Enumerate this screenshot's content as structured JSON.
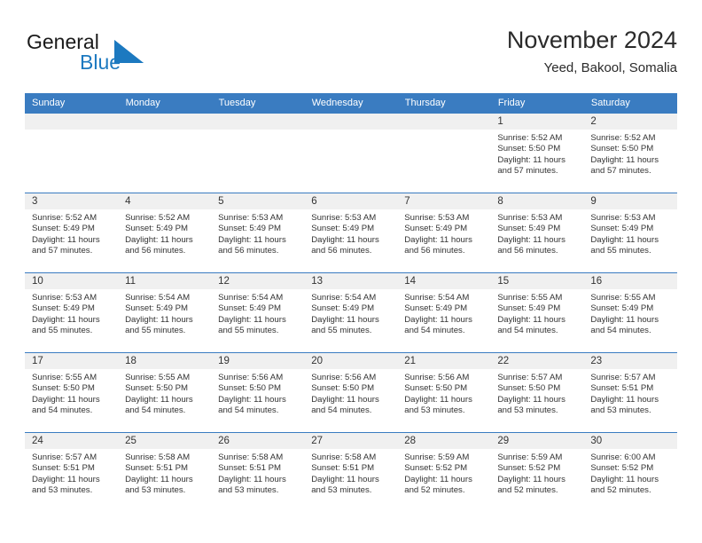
{
  "brand": {
    "name_part1": "General",
    "name_part2": "Blue",
    "accent_color": "#1c79c0",
    "logo_icon": "triangle-logo-icon"
  },
  "header": {
    "title": "November 2024",
    "subtitle": "Yeed, Bakool, Somalia"
  },
  "calendar": {
    "header_bg": "#3a7cc1",
    "daynum_bg": "#f0f0f0",
    "weekdays": [
      "Sunday",
      "Monday",
      "Tuesday",
      "Wednesday",
      "Thursday",
      "Friday",
      "Saturday"
    ],
    "weeks": [
      [
        {
          "day": "",
          "empty": true
        },
        {
          "day": "",
          "empty": true
        },
        {
          "day": "",
          "empty": true
        },
        {
          "day": "",
          "empty": true
        },
        {
          "day": "",
          "empty": true
        },
        {
          "day": "1",
          "sunrise": "Sunrise: 5:52 AM",
          "sunset": "Sunset: 5:50 PM",
          "daylight1": "Daylight: 11 hours",
          "daylight2": "and 57 minutes."
        },
        {
          "day": "2",
          "sunrise": "Sunrise: 5:52 AM",
          "sunset": "Sunset: 5:50 PM",
          "daylight1": "Daylight: 11 hours",
          "daylight2": "and 57 minutes."
        }
      ],
      [
        {
          "day": "3",
          "sunrise": "Sunrise: 5:52 AM",
          "sunset": "Sunset: 5:49 PM",
          "daylight1": "Daylight: 11 hours",
          "daylight2": "and 57 minutes."
        },
        {
          "day": "4",
          "sunrise": "Sunrise: 5:52 AM",
          "sunset": "Sunset: 5:49 PM",
          "daylight1": "Daylight: 11 hours",
          "daylight2": "and 56 minutes."
        },
        {
          "day": "5",
          "sunrise": "Sunrise: 5:53 AM",
          "sunset": "Sunset: 5:49 PM",
          "daylight1": "Daylight: 11 hours",
          "daylight2": "and 56 minutes."
        },
        {
          "day": "6",
          "sunrise": "Sunrise: 5:53 AM",
          "sunset": "Sunset: 5:49 PM",
          "daylight1": "Daylight: 11 hours",
          "daylight2": "and 56 minutes."
        },
        {
          "day": "7",
          "sunrise": "Sunrise: 5:53 AM",
          "sunset": "Sunset: 5:49 PM",
          "daylight1": "Daylight: 11 hours",
          "daylight2": "and 56 minutes."
        },
        {
          "day": "8",
          "sunrise": "Sunrise: 5:53 AM",
          "sunset": "Sunset: 5:49 PM",
          "daylight1": "Daylight: 11 hours",
          "daylight2": "and 56 minutes."
        },
        {
          "day": "9",
          "sunrise": "Sunrise: 5:53 AM",
          "sunset": "Sunset: 5:49 PM",
          "daylight1": "Daylight: 11 hours",
          "daylight2": "and 55 minutes."
        }
      ],
      [
        {
          "day": "10",
          "sunrise": "Sunrise: 5:53 AM",
          "sunset": "Sunset: 5:49 PM",
          "daylight1": "Daylight: 11 hours",
          "daylight2": "and 55 minutes."
        },
        {
          "day": "11",
          "sunrise": "Sunrise: 5:54 AM",
          "sunset": "Sunset: 5:49 PM",
          "daylight1": "Daylight: 11 hours",
          "daylight2": "and 55 minutes."
        },
        {
          "day": "12",
          "sunrise": "Sunrise: 5:54 AM",
          "sunset": "Sunset: 5:49 PM",
          "daylight1": "Daylight: 11 hours",
          "daylight2": "and 55 minutes."
        },
        {
          "day": "13",
          "sunrise": "Sunrise: 5:54 AM",
          "sunset": "Sunset: 5:49 PM",
          "daylight1": "Daylight: 11 hours",
          "daylight2": "and 55 minutes."
        },
        {
          "day": "14",
          "sunrise": "Sunrise: 5:54 AM",
          "sunset": "Sunset: 5:49 PM",
          "daylight1": "Daylight: 11 hours",
          "daylight2": "and 54 minutes."
        },
        {
          "day": "15",
          "sunrise": "Sunrise: 5:55 AM",
          "sunset": "Sunset: 5:49 PM",
          "daylight1": "Daylight: 11 hours",
          "daylight2": "and 54 minutes."
        },
        {
          "day": "16",
          "sunrise": "Sunrise: 5:55 AM",
          "sunset": "Sunset: 5:49 PM",
          "daylight1": "Daylight: 11 hours",
          "daylight2": "and 54 minutes."
        }
      ],
      [
        {
          "day": "17",
          "sunrise": "Sunrise: 5:55 AM",
          "sunset": "Sunset: 5:50 PM",
          "daylight1": "Daylight: 11 hours",
          "daylight2": "and 54 minutes."
        },
        {
          "day": "18",
          "sunrise": "Sunrise: 5:55 AM",
          "sunset": "Sunset: 5:50 PM",
          "daylight1": "Daylight: 11 hours",
          "daylight2": "and 54 minutes."
        },
        {
          "day": "19",
          "sunrise": "Sunrise: 5:56 AM",
          "sunset": "Sunset: 5:50 PM",
          "daylight1": "Daylight: 11 hours",
          "daylight2": "and 54 minutes."
        },
        {
          "day": "20",
          "sunrise": "Sunrise: 5:56 AM",
          "sunset": "Sunset: 5:50 PM",
          "daylight1": "Daylight: 11 hours",
          "daylight2": "and 54 minutes."
        },
        {
          "day": "21",
          "sunrise": "Sunrise: 5:56 AM",
          "sunset": "Sunset: 5:50 PM",
          "daylight1": "Daylight: 11 hours",
          "daylight2": "and 53 minutes."
        },
        {
          "day": "22",
          "sunrise": "Sunrise: 5:57 AM",
          "sunset": "Sunset: 5:50 PM",
          "daylight1": "Daylight: 11 hours",
          "daylight2": "and 53 minutes."
        },
        {
          "day": "23",
          "sunrise": "Sunrise: 5:57 AM",
          "sunset": "Sunset: 5:51 PM",
          "daylight1": "Daylight: 11 hours",
          "daylight2": "and 53 minutes."
        }
      ],
      [
        {
          "day": "24",
          "sunrise": "Sunrise: 5:57 AM",
          "sunset": "Sunset: 5:51 PM",
          "daylight1": "Daylight: 11 hours",
          "daylight2": "and 53 minutes."
        },
        {
          "day": "25",
          "sunrise": "Sunrise: 5:58 AM",
          "sunset": "Sunset: 5:51 PM",
          "daylight1": "Daylight: 11 hours",
          "daylight2": "and 53 minutes."
        },
        {
          "day": "26",
          "sunrise": "Sunrise: 5:58 AM",
          "sunset": "Sunset: 5:51 PM",
          "daylight1": "Daylight: 11 hours",
          "daylight2": "and 53 minutes."
        },
        {
          "day": "27",
          "sunrise": "Sunrise: 5:58 AM",
          "sunset": "Sunset: 5:51 PM",
          "daylight1": "Daylight: 11 hours",
          "daylight2": "and 53 minutes."
        },
        {
          "day": "28",
          "sunrise": "Sunrise: 5:59 AM",
          "sunset": "Sunset: 5:52 PM",
          "daylight1": "Daylight: 11 hours",
          "daylight2": "and 52 minutes."
        },
        {
          "day": "29",
          "sunrise": "Sunrise: 5:59 AM",
          "sunset": "Sunset: 5:52 PM",
          "daylight1": "Daylight: 11 hours",
          "daylight2": "and 52 minutes."
        },
        {
          "day": "30",
          "sunrise": "Sunrise: 6:00 AM",
          "sunset": "Sunset: 5:52 PM",
          "daylight1": "Daylight: 11 hours",
          "daylight2": "and 52 minutes."
        }
      ]
    ]
  }
}
